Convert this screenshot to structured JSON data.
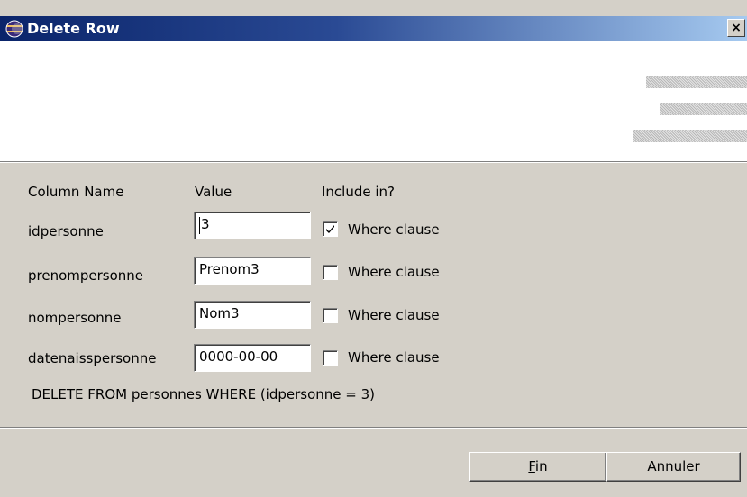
{
  "window": {
    "title": "Delete Row",
    "close_glyph": "×"
  },
  "colors": {
    "titlebar_start": "#0a246a",
    "titlebar_end": "#a6caf0",
    "dialog_bg": "#d4d0c8"
  },
  "headers": {
    "column_name": "Column Name",
    "value": "Value",
    "include_in": "Include in?"
  },
  "rows": [
    {
      "column": "idpersonne",
      "value": "3",
      "checkbox_label": "Where clause",
      "checked": true
    },
    {
      "column": "prenompersonne",
      "value": "Prenom3",
      "checkbox_label": "Where clause",
      "checked": false
    },
    {
      "column": "nompersonne",
      "value": "Nom3",
      "checkbox_label": "Where clause",
      "checked": false
    },
    {
      "column": "datenaisspersonne",
      "value": "0000-00-00",
      "checkbox_label": "Where clause",
      "checked": false
    }
  ],
  "sql_preview": "DELETE FROM personnes WHERE (idpersonne = 3)",
  "buttons": {
    "finish_mnemonic": "F",
    "finish_rest": "in",
    "cancel": "Annuler"
  },
  "icons": {
    "app": "eclipse-icon",
    "check": "checkmark-icon"
  }
}
